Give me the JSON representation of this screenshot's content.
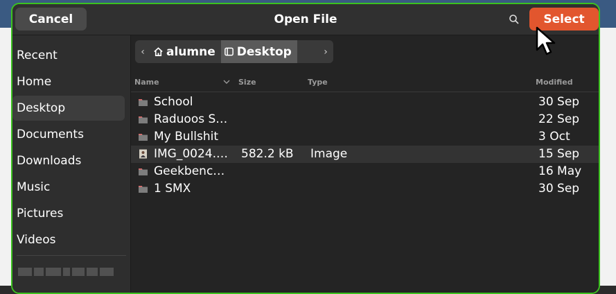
{
  "dialog": {
    "title": "Open File",
    "cancel_label": "Cancel",
    "select_label": "Select",
    "search_icon": "search-icon",
    "accent_color": "#e2562e",
    "focus_border_color": "#3cc21f"
  },
  "sidebar": {
    "items": [
      {
        "label": "Recent",
        "active": false
      },
      {
        "label": "Home",
        "active": false
      },
      {
        "label": "Desktop",
        "active": true
      },
      {
        "label": "Documents",
        "active": false
      },
      {
        "label": "Downloads",
        "active": false
      },
      {
        "label": "Music",
        "active": false
      },
      {
        "label": "Pictures",
        "active": false
      },
      {
        "label": "Videos",
        "active": false
      }
    ]
  },
  "pathbar": {
    "home_icon": "home-icon",
    "home_label": "alumne",
    "current_icon": "desktop-icon",
    "current_label": "Desktop"
  },
  "columns": {
    "name": "Name",
    "size": "Size",
    "type": "Type",
    "modified": "Modified"
  },
  "files": [
    {
      "name": "School",
      "size": "",
      "type": "",
      "modified": "30 Sep",
      "icon": "folder-icon",
      "selected": false
    },
    {
      "name": "Raduoos S…",
      "size": "",
      "type": "",
      "modified": "22 Sep",
      "icon": "folder-icon",
      "selected": false
    },
    {
      "name": "My Bullshit",
      "size": "",
      "type": "",
      "modified": "3 Oct",
      "icon": "folder-icon",
      "selected": false
    },
    {
      "name": "IMG_0024.…",
      "size": "582.2 kB",
      "type": "Image",
      "modified": "15 Sep",
      "icon": "image-file-icon",
      "selected": true
    },
    {
      "name": "Geekbenc…",
      "size": "",
      "type": "",
      "modified": "16 May",
      "icon": "folder-icon",
      "selected": false
    },
    {
      "name": "1 SMX",
      "size": "",
      "type": "",
      "modified": "30 Sep",
      "icon": "folder-icon",
      "selected": false
    }
  ]
}
